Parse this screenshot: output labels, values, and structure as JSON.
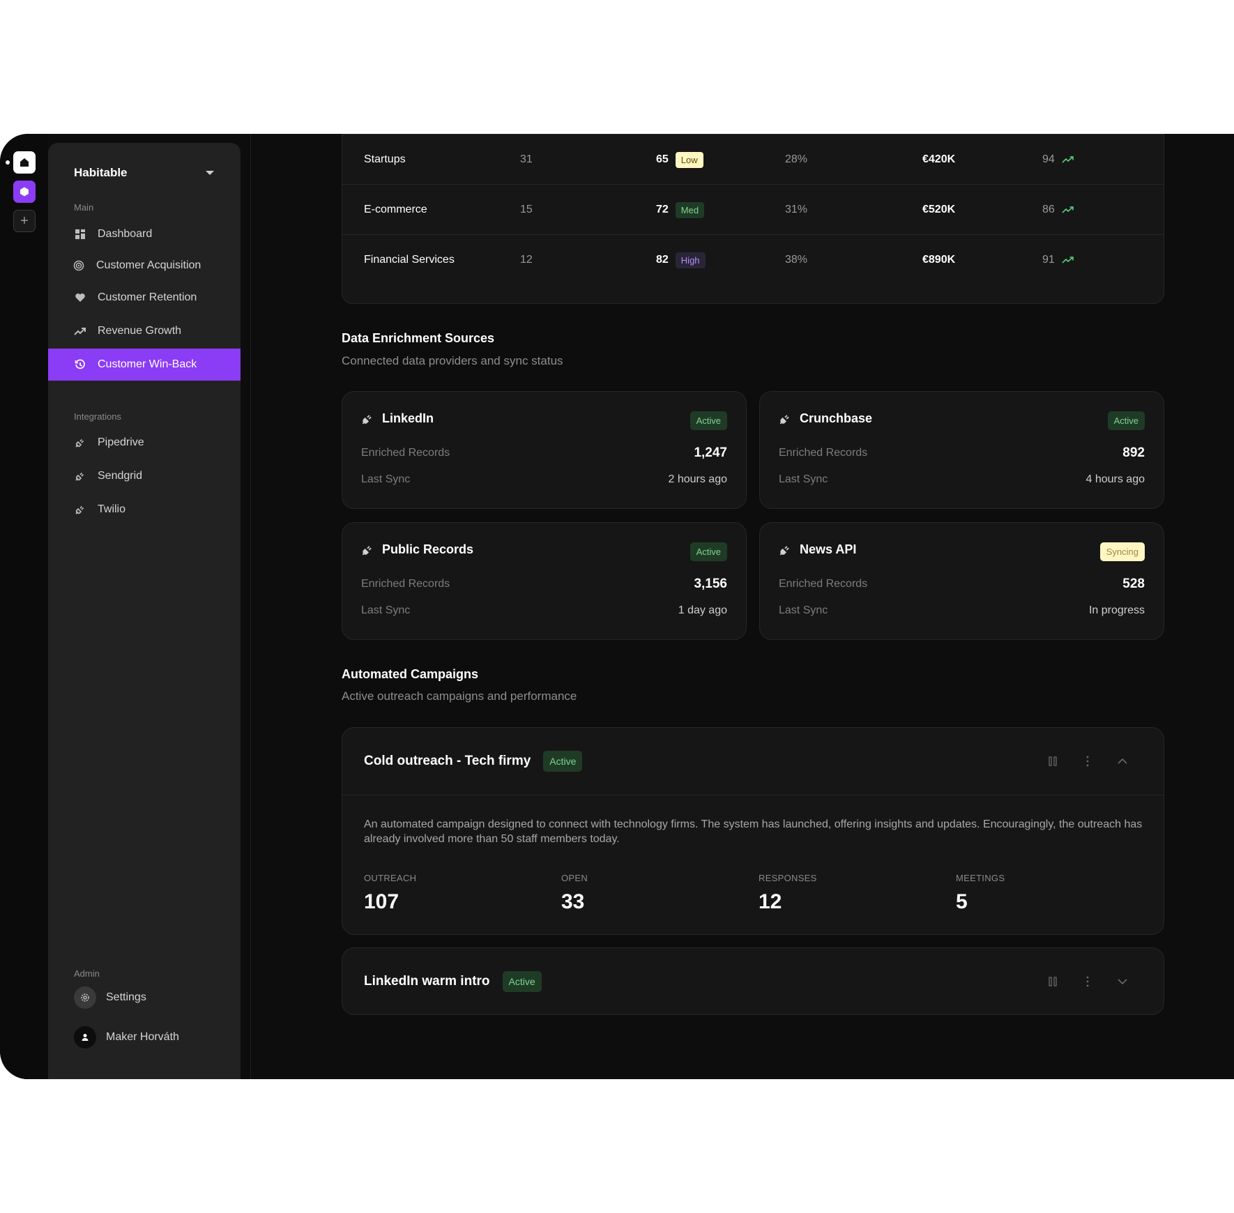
{
  "sidebar": {
    "workspace": "Habitable",
    "sections": {
      "main": "Main",
      "integrations": "Integrations",
      "admin": "Admin"
    },
    "main_items": [
      {
        "label": "Dashboard",
        "icon": "grid-icon"
      },
      {
        "label": "Customer Acquisition",
        "icon": "target-icon"
      },
      {
        "label": "Customer Retention",
        "icon": "heart-icon"
      },
      {
        "label": "Revenue Growth",
        "icon": "trend-up-icon"
      },
      {
        "label": "Customer Win-Back",
        "icon": "history-icon",
        "active": true
      }
    ],
    "integration_items": [
      {
        "label": "Pipedrive",
        "icon": "plug-icon"
      },
      {
        "label": "Sendgrid",
        "icon": "plug-icon"
      },
      {
        "label": "Twilio",
        "icon": "plug-icon"
      }
    ],
    "settings_label": "Settings",
    "user_name": "Maker Horváth"
  },
  "segments": {
    "rows": [
      {
        "name": "Startups",
        "count": "31",
        "score": "65",
        "level": "Low",
        "rate": "28%",
        "value": "€420K",
        "trend": "94"
      },
      {
        "name": "E-commerce",
        "count": "15",
        "score": "72",
        "level": "Med",
        "rate": "31%",
        "value": "€520K",
        "trend": "86"
      },
      {
        "name": "Financial Services",
        "count": "12",
        "score": "82",
        "level": "High",
        "rate": "38%",
        "value": "€890K",
        "trend": "91"
      }
    ]
  },
  "enrichment": {
    "title": "Data Enrichment Sources",
    "subtitle": "Connected data providers and sync status",
    "records_label": "Enriched Records",
    "sync_label": "Last Sync",
    "sources": [
      {
        "name": "LinkedIn",
        "status": "Active",
        "records": "1,247",
        "last_sync": "2 hours ago"
      },
      {
        "name": "Crunchbase",
        "status": "Active",
        "records": "892",
        "last_sync": "4 hours ago"
      },
      {
        "name": "Public Records",
        "status": "Active",
        "records": "3,156",
        "last_sync": "1 day ago"
      },
      {
        "name": "News API",
        "status": "Syncing",
        "records": "528",
        "last_sync": "In progress"
      }
    ]
  },
  "campaigns": {
    "title": "Automated Campaigns",
    "subtitle": "Active outreach campaigns and performance",
    "items": [
      {
        "name": "Cold outreach - Tech firmy",
        "status": "Active",
        "description": "An automated campaign designed to connect with technology firms. The system has launched, offering insights and updates. Encouragingly, the outreach has already involved more than 50 staff members today.",
        "stats": [
          {
            "label": "OUTREACH",
            "value": "107"
          },
          {
            "label": "OPEN",
            "value": "33"
          },
          {
            "label": "RESPONSES",
            "value": "12"
          },
          {
            "label": "MEETINGS",
            "value": "5"
          }
        ]
      },
      {
        "name": "LinkedIn warm intro",
        "status": "Active"
      }
    ]
  },
  "colors": {
    "accent": "#8b3cf5",
    "active_badge": "#1f3b26",
    "syncing_badge": "#fff6c2"
  }
}
